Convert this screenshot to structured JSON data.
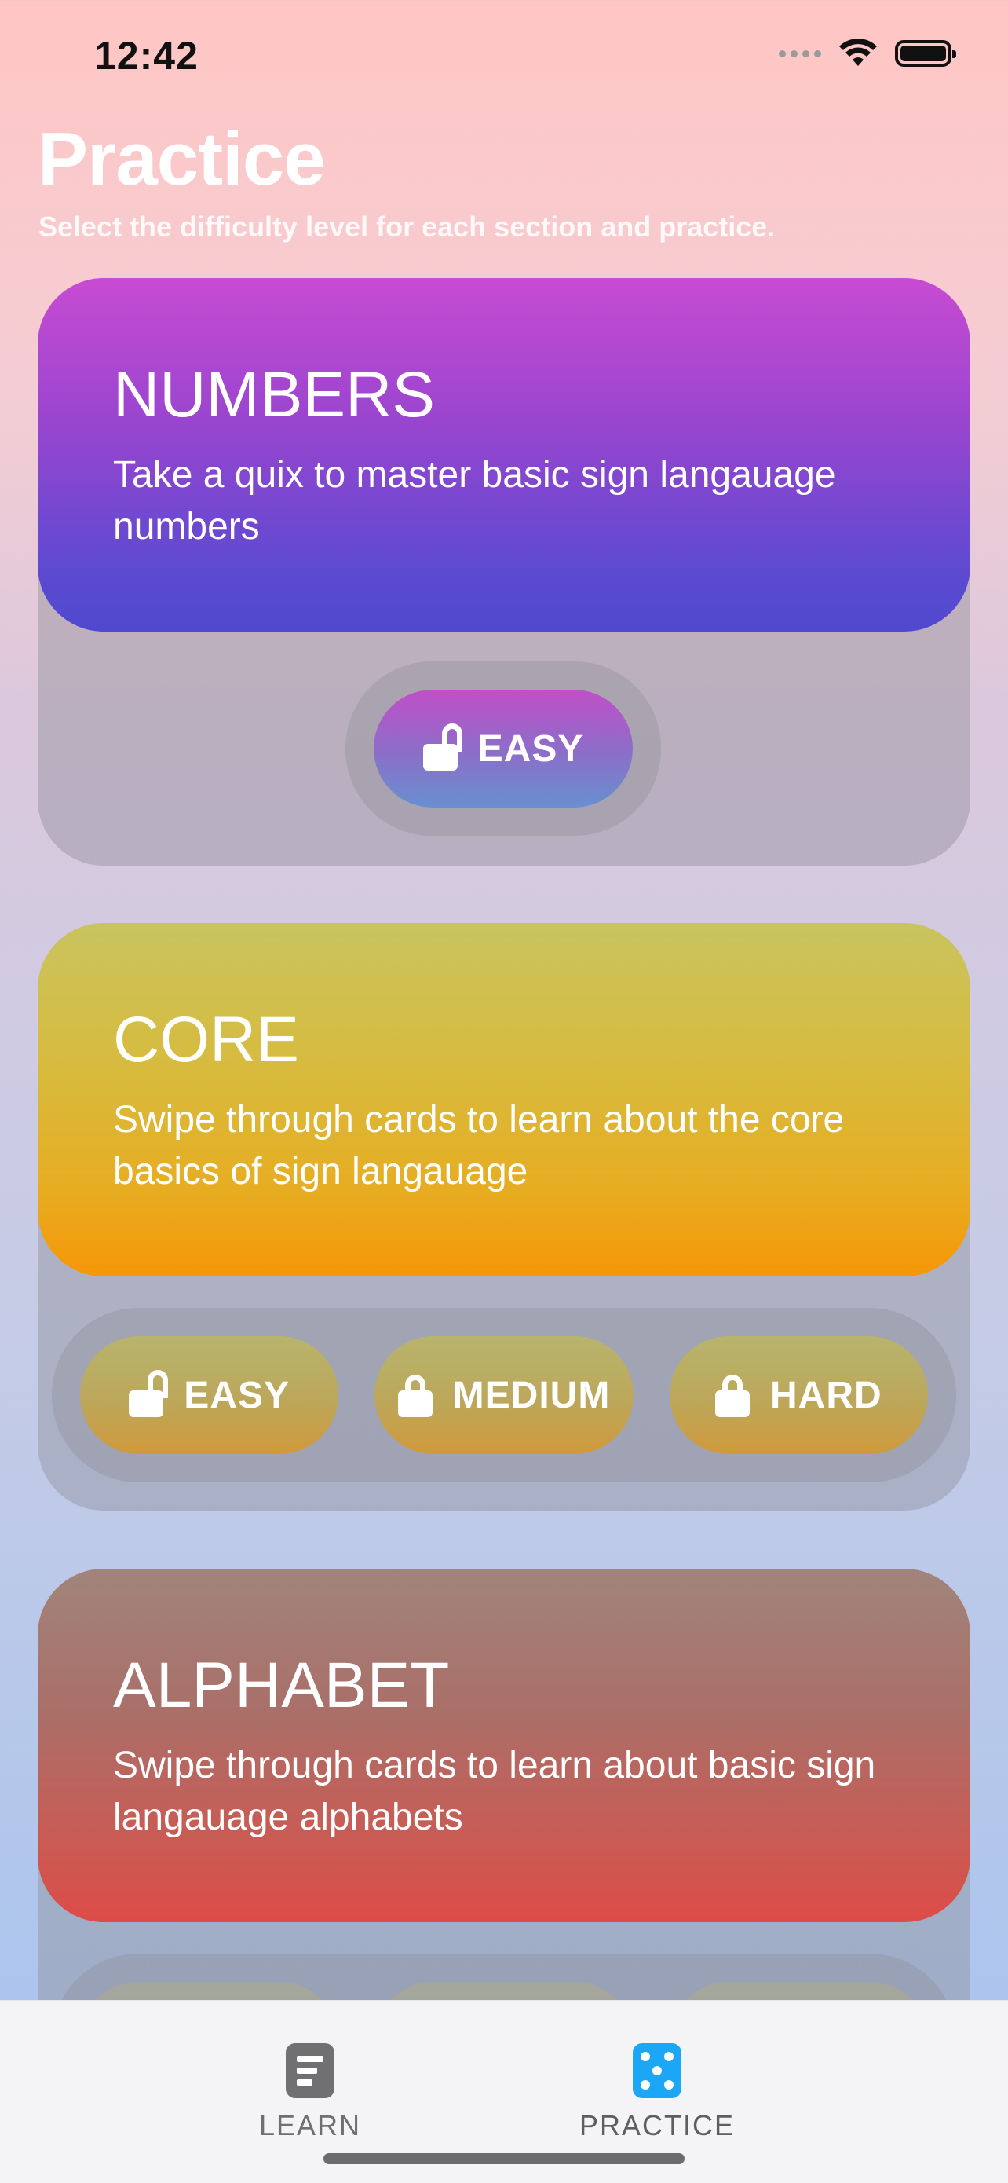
{
  "status_bar": {
    "time": "12:42"
  },
  "header": {
    "title": "Practice",
    "subtitle": "Select the difficulty level for each section and practice."
  },
  "sections": [
    {
      "title": "NUMBERS",
      "description": "Take a quix to master basic sign langauage numbers",
      "levels": [
        {
          "label": "EASY",
          "locked": false
        }
      ]
    },
    {
      "title": "CORE",
      "description": "Swipe through cards to learn about the core basics of sign langauage",
      "levels": [
        {
          "label": "EASY",
          "locked": false
        },
        {
          "label": "MEDIUM",
          "locked": true
        },
        {
          "label": "HARD",
          "locked": true
        }
      ]
    },
    {
      "title": "ALPHABET",
      "description": "Swipe through cards to learn about basic sign langauage alphabets"
    }
  ],
  "tab_bar": {
    "tabs": [
      {
        "label": "LEARN",
        "icon": "book-icon",
        "selected": false
      },
      {
        "label": "PRACTICE",
        "icon": "dice-icon",
        "selected": true
      }
    ]
  }
}
